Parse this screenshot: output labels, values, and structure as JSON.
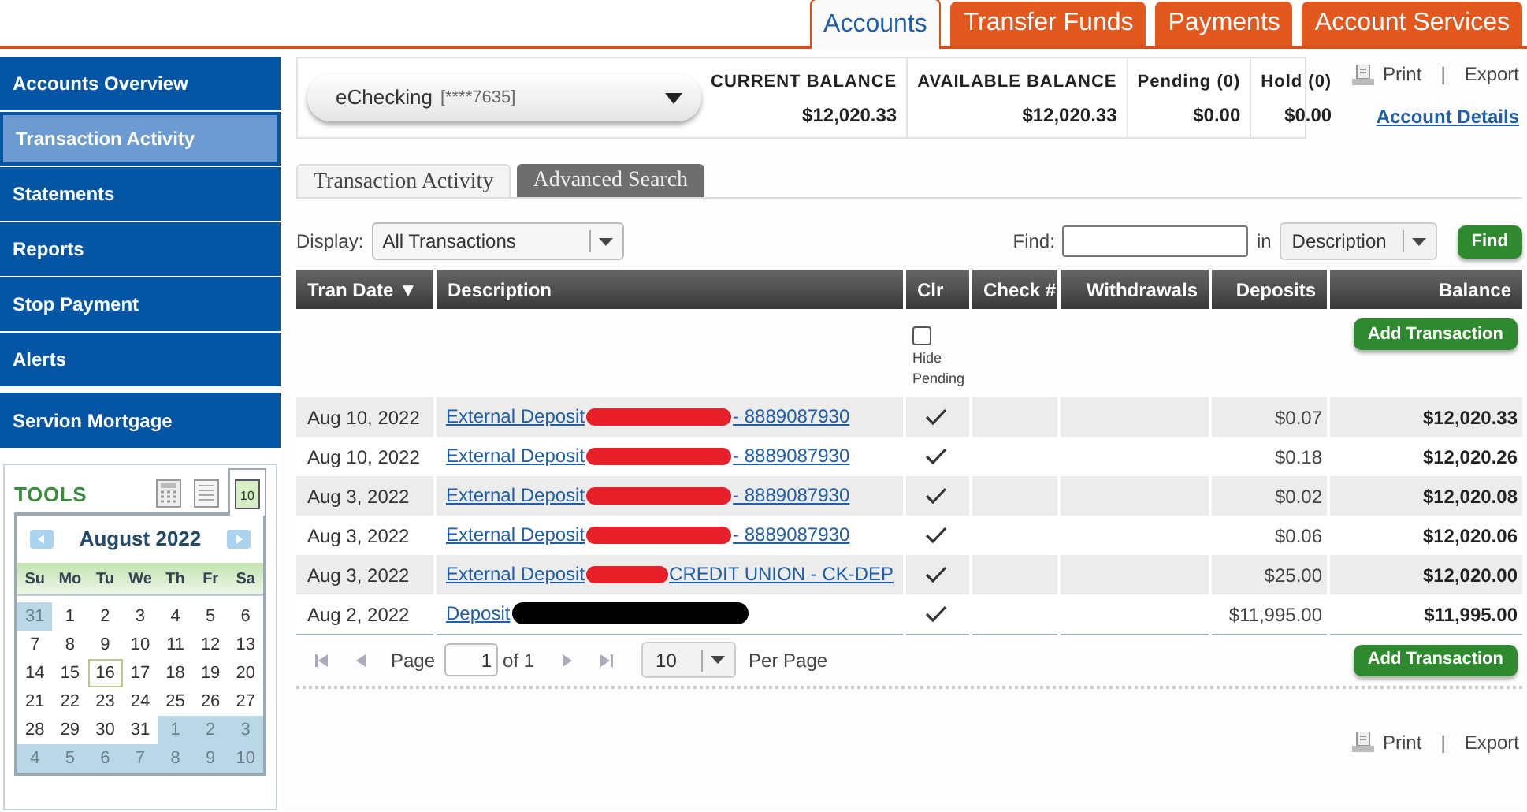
{
  "top_tabs": [
    {
      "label": "Accounts",
      "selected": true
    },
    {
      "label": "Transfer Funds",
      "selected": false
    },
    {
      "label": "Payments",
      "selected": false
    },
    {
      "label": "Account Services",
      "selected": false
    }
  ],
  "sidebar": {
    "items": [
      {
        "label": "Accounts Overview",
        "selected": false
      },
      {
        "label": "Transaction Activity",
        "selected": true
      },
      {
        "label": "Statements",
        "selected": false
      },
      {
        "label": "Reports",
        "selected": false
      },
      {
        "label": "Stop Payment",
        "selected": false
      },
      {
        "label": "Alerts",
        "selected": false
      },
      {
        "label": "Servion Mortgage",
        "selected": false
      }
    ]
  },
  "tools": {
    "title": "TOOLS",
    "icons": [
      {
        "kind": "calculator",
        "selected": false
      },
      {
        "kind": "notes",
        "selected": false
      },
      {
        "kind": "calendar",
        "selected": true,
        "label": "10"
      }
    ],
    "calendar": {
      "month": "August 2022",
      "weekdays": [
        "Su",
        "Mo",
        "Tu",
        "We",
        "Th",
        "Fr",
        "Sa"
      ],
      "weeks": [
        [
          {
            "day": "31",
            "outside": true,
            "selected": false
          },
          {
            "day": "1",
            "outside": false,
            "selected": false
          },
          {
            "day": "2",
            "outside": false,
            "selected": false
          },
          {
            "day": "3",
            "outside": false,
            "selected": false
          },
          {
            "day": "4",
            "outside": false,
            "selected": false
          },
          {
            "day": "5",
            "outside": false,
            "selected": false
          },
          {
            "day": "6",
            "outside": false,
            "selected": false
          }
        ],
        [
          {
            "day": "7",
            "outside": false,
            "selected": false
          },
          {
            "day": "8",
            "outside": false,
            "selected": false
          },
          {
            "day": "9",
            "outside": false,
            "selected": false
          },
          {
            "day": "10",
            "outside": false,
            "selected": false
          },
          {
            "day": "11",
            "outside": false,
            "selected": false
          },
          {
            "day": "12",
            "outside": false,
            "selected": false
          },
          {
            "day": "13",
            "outside": false,
            "selected": false
          }
        ],
        [
          {
            "day": "14",
            "outside": false,
            "selected": false
          },
          {
            "day": "15",
            "outside": false,
            "selected": false
          },
          {
            "day": "16",
            "outside": false,
            "selected": true
          },
          {
            "day": "17",
            "outside": false,
            "selected": false
          },
          {
            "day": "18",
            "outside": false,
            "selected": false
          },
          {
            "day": "19",
            "outside": false,
            "selected": false
          },
          {
            "day": "20",
            "outside": false,
            "selected": false
          }
        ],
        [
          {
            "day": "21",
            "outside": false,
            "selected": false
          },
          {
            "day": "22",
            "outside": false,
            "selected": false
          },
          {
            "day": "23",
            "outside": false,
            "selected": false
          },
          {
            "day": "24",
            "outside": false,
            "selected": false
          },
          {
            "day": "25",
            "outside": false,
            "selected": false
          },
          {
            "day": "26",
            "outside": false,
            "selected": false
          },
          {
            "day": "27",
            "outside": false,
            "selected": false
          }
        ],
        [
          {
            "day": "28",
            "outside": false,
            "selected": false
          },
          {
            "day": "29",
            "outside": false,
            "selected": false
          },
          {
            "day": "30",
            "outside": false,
            "selected": false
          },
          {
            "day": "31",
            "outside": false,
            "selected": false
          },
          {
            "day": "1",
            "outside": true,
            "selected": false
          },
          {
            "day": "2",
            "outside": true,
            "selected": false
          },
          {
            "day": "3",
            "outside": true,
            "selected": false
          }
        ],
        [
          {
            "day": "4",
            "outside": true,
            "selected": false
          },
          {
            "day": "5",
            "outside": true,
            "selected": false
          },
          {
            "day": "6",
            "outside": true,
            "selected": false
          },
          {
            "day": "7",
            "outside": true,
            "selected": false
          },
          {
            "day": "8",
            "outside": true,
            "selected": false
          },
          {
            "day": "9",
            "outside": true,
            "selected": false
          },
          {
            "day": "10",
            "outside": true,
            "selected": false
          }
        ]
      ]
    }
  },
  "account": {
    "name": "eChecking",
    "number": "[****7635]",
    "balances": [
      {
        "label": "CURRENT BALANCE",
        "value": "$12,020.33"
      },
      {
        "label": "AVAILABLE BALANCE",
        "value": "$12,020.33"
      },
      {
        "label": "Pending (0)",
        "value": "$0.00"
      },
      {
        "label": "Hold (0)",
        "value": "$0.00"
      }
    ],
    "print": "Print",
    "separator": "|",
    "export": "Export",
    "details_link": "Account Details"
  },
  "view_tabs": [
    {
      "label": "Transaction Activity",
      "selected": true
    },
    {
      "label": "Advanced Search",
      "selected": false
    }
  ],
  "filter": {
    "display_label": "Display:",
    "display_value": "All Transactions",
    "find_label": "Find:",
    "in_label": "in",
    "field_value": "Description",
    "find_button": "Find"
  },
  "table": {
    "columns": [
      "Tran Date ▼",
      "Description",
      "Clr",
      "Check #",
      "Withdrawals",
      "Deposits",
      "Balance"
    ],
    "add_button": "Add Transaction",
    "hide_pending": {
      "label": "Hide Pending",
      "checked": false
    },
    "rows": [
      {
        "date": "Aug 10, 2022",
        "desc_start": "External Deposit",
        "color": "#e8202a",
        "desc_end": "- 8889087930",
        "cleared": true,
        "deposit": "$0.07",
        "balance": "$12,020.33"
      },
      {
        "date": "Aug 10, 2022",
        "desc_start": "External Deposit",
        "color": "#e8202a",
        "desc_end": "- 8889087930",
        "cleared": true,
        "deposit": "$0.18",
        "balance": "$12,020.26"
      },
      {
        "date": "Aug 3, 2022",
        "desc_start": "External Deposit",
        "color": "#e8202a",
        "desc_end": "- 8889087930",
        "cleared": true,
        "deposit": "$0.02",
        "balance": "$12,020.08"
      },
      {
        "date": "Aug 3, 2022",
        "desc_start": "External Deposit",
        "color": "#e8202a",
        "desc_end": "- 8889087930",
        "cleared": true,
        "deposit": "$0.06",
        "balance": "$12,020.06"
      },
      {
        "date": "Aug 3, 2022",
        "desc_start": "External Deposit",
        "color": "#e8202a",
        "desc_end": "CREDIT UNION - CK-DEP",
        "cleared": true,
        "deposit": "$25.00",
        "balance": "$12,020.00"
      },
      {
        "date": "Aug 2, 2022",
        "desc_start": "Deposit",
        "color": "#000000",
        "cleared": true,
        "deposit": "$11,995.00",
        "balance": "$11,995.00"
      }
    ]
  },
  "pager": {
    "page_label": "Page",
    "page": "1",
    "of": "of 1",
    "per_page": "10",
    "per_page_label": "Per Page",
    "add_button": "Add Transaction"
  },
  "footer": {
    "print": "Print",
    "separator": "|",
    "export": "Export"
  }
}
